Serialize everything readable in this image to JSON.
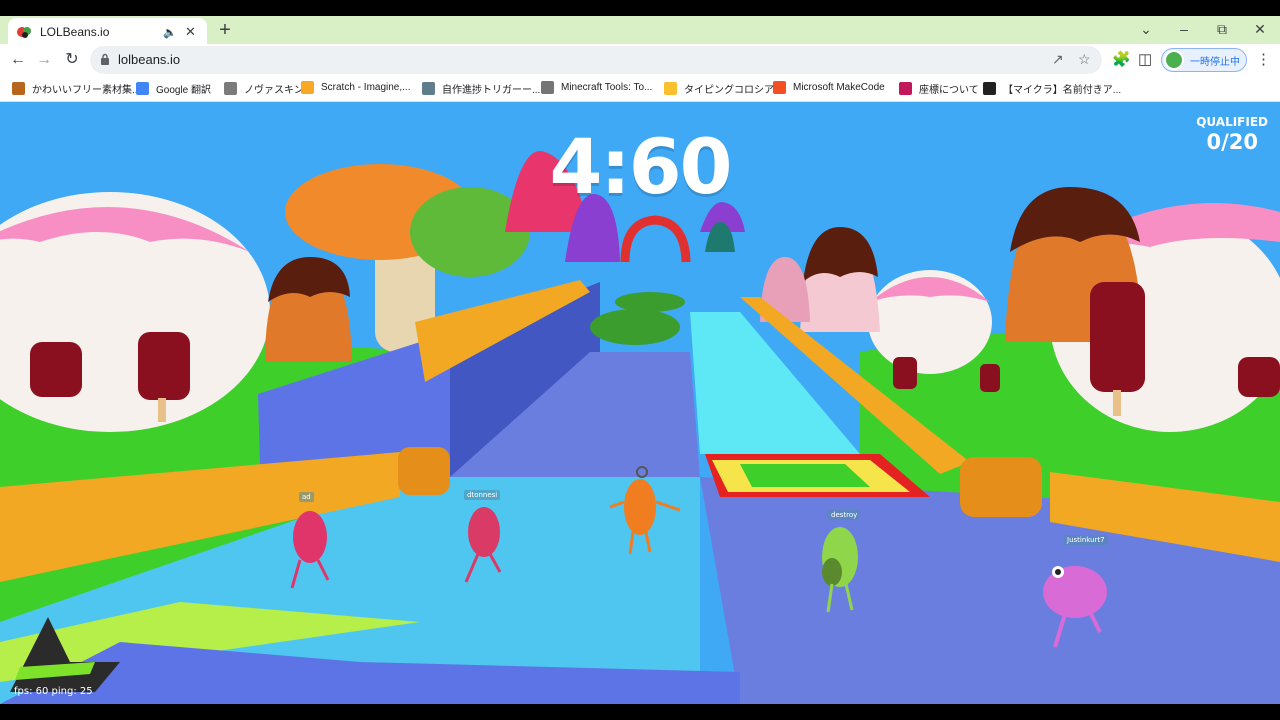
{
  "browser": {
    "tab": {
      "title": "LOLBeans.io"
    },
    "url": "lolbeans.io",
    "profile_label": "一時停止中",
    "bookmarks": [
      {
        "label": "かわいいフリー素材集...",
        "color": "#b8651e"
      },
      {
        "label": "Google 翻訳",
        "color": "#4285f4"
      },
      {
        "label": "ノヴァスキン",
        "color": "#7b7b7b"
      },
      {
        "label": "Scratch - Imagine,...",
        "color": "#f9a825"
      },
      {
        "label": "自作進捗トリガーー...",
        "color": "#607d8b"
      },
      {
        "label": "Minecraft Tools: To...",
        "color": "#757575"
      },
      {
        "label": "タイピングコロシアム",
        "color": "#fbc02d"
      },
      {
        "label": "Microsoft MakeCode",
        "color": "#f25022"
      },
      {
        "label": "座標について",
        "color": "#c2185b"
      },
      {
        "label": "【マイクラ】名前付きア...",
        "color": "#212121"
      }
    ]
  },
  "game": {
    "timer": "4:60",
    "qualified_label": "QUALIFIED",
    "qualified_value": "0/20",
    "fps_text": "fps: 60 ping: 25",
    "players": [
      {
        "name": "ad",
        "color": "#e0356b"
      },
      {
        "name": "dtonnesi",
        "color": "#d93a66"
      },
      {
        "name": "",
        "color": "#f07d1f"
      },
      {
        "name": "destroy",
        "color": "#8fd64a"
      },
      {
        "name": "Justinkurt7",
        "color": "#d96bd6"
      }
    ]
  },
  "colors": {
    "sky": "#3fa9f5",
    "grass": "#3ecf2a",
    "track_blue": "#6a7ee0",
    "track_light": "#4fc6f0",
    "rail": "#f2a823",
    "water": "#5ee8f5"
  }
}
